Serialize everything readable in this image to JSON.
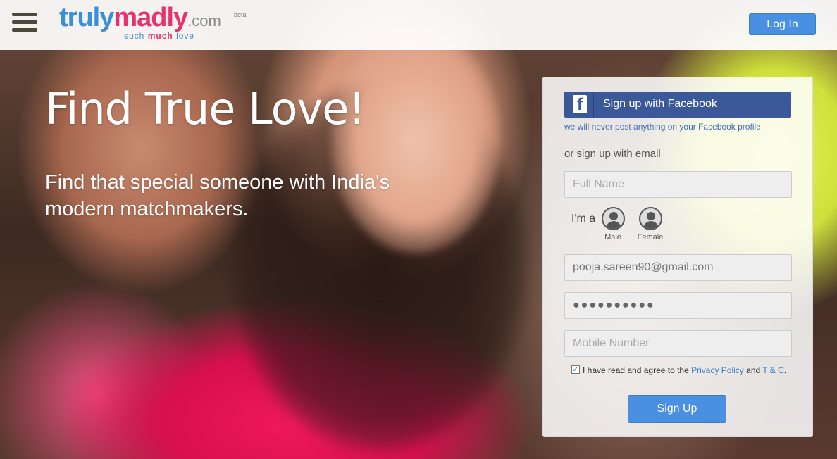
{
  "header": {
    "logo_truly": "truly",
    "logo_madly": "madly",
    "logo_com": ".com",
    "logo_beta": "beta",
    "tagline_such": "such",
    "tagline_much": "much",
    "tagline_love": "love",
    "login_label": "Log In",
    "menu_icon": "hamburger-menu-icon"
  },
  "hero": {
    "title": "Find True Love!",
    "subtitle": "Find that special someone with India's modern matchmakers."
  },
  "signup": {
    "facebook_button": "Sign up with Facebook",
    "facebook_icon": "facebook-icon",
    "facebook_note": "we will never post anything on your Facebook profile",
    "or_email": "or sign up with email",
    "full_name_placeholder": "Full Name",
    "gender_label": "I'm a",
    "gender_male": "Male",
    "gender_female": "Female",
    "email_value": "pooja.sareen90@gmail.com",
    "password_value": "●●●●●●●●●●",
    "mobile_placeholder": "Mobile Number",
    "agree_checked": true,
    "agree_text": "I have read and agree to the",
    "privacy_link": "Privacy Policy",
    "and_text": "and",
    "tc_link": "T & C",
    "period": ".",
    "signup_button": "Sign Up"
  },
  "colors": {
    "brand_blue": "#3b8fd6",
    "brand_pink": "#e8326f",
    "facebook_blue": "#3b5998",
    "button_blue": "#4a90e2"
  }
}
